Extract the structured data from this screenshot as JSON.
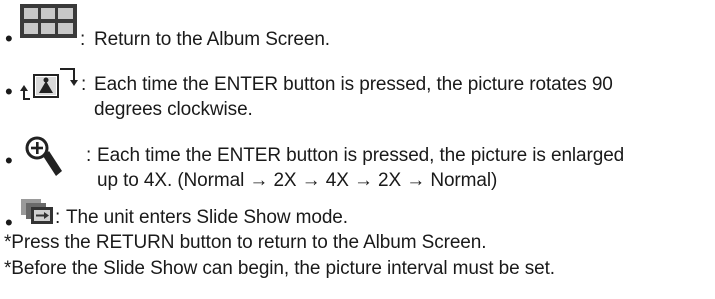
{
  "items": [
    {
      "icon": "album-grid-icon",
      "separator": ":",
      "lines": [
        "Return to the Album Screen."
      ]
    },
    {
      "icon": "rotate-picture-icon",
      "separator": ":",
      "lines": [
        "Each time the ENTER button is pressed, the picture rotates 90",
        "degrees clockwise."
      ]
    },
    {
      "icon": "zoom-in-icon",
      "separator": ":",
      "lines": [
        "Each time the ENTER button is pressed, the picture is enlarged",
        "up to 4X. (Normal → 2X → 4X → 2X → Normal)"
      ]
    },
    {
      "icon": "slide-show-icon",
      "separator": ":",
      "lines": [
        "The unit enters Slide Show mode."
      ]
    }
  ],
  "notes": [
    "*Press the RETURN button to return to the Album Screen.",
    "*Before the Slide Show can begin, the picture interval must be set."
  ],
  "colors": {
    "text": "#1a1a1a",
    "icon_dark": "#333333",
    "icon_mid": "#666666",
    "icon_light": "#bdbdbd"
  }
}
